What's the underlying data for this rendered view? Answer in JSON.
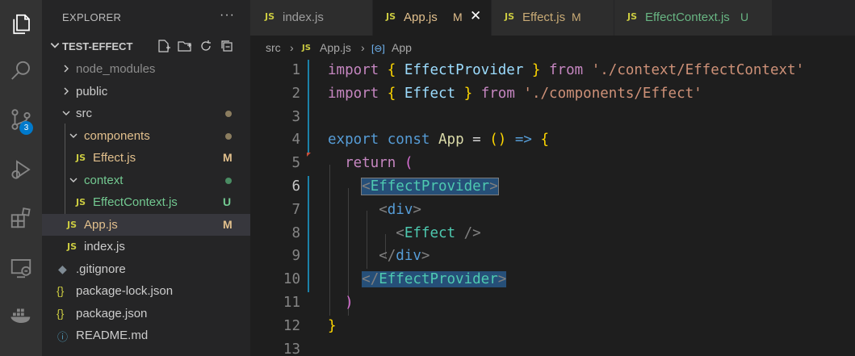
{
  "activity_bar": {
    "icons": [
      "explorer-icon",
      "search-icon",
      "source-control-icon",
      "run-debug-icon",
      "extensions-icon",
      "remote-explorer-icon",
      "docker-icon"
    ],
    "source_control_badge": "3"
  },
  "sidebar": {
    "title": "EXPLORER",
    "more": "···",
    "project": "TEST-EFFECT",
    "tree": [
      {
        "label": "node_modules",
        "type": "folder",
        "state": "collapsed"
      },
      {
        "label": "public",
        "type": "folder",
        "state": "collapsed"
      },
      {
        "label": "src",
        "type": "folder",
        "state": "expanded"
      },
      {
        "label": "components",
        "type": "folder",
        "state": "expanded"
      },
      {
        "label": "Effect.js",
        "type": "js",
        "status": "M"
      },
      {
        "label": "context",
        "type": "folder",
        "state": "expanded"
      },
      {
        "label": "EffectContext.js",
        "type": "js",
        "status": "U"
      },
      {
        "label": "App.js",
        "type": "js",
        "status": "M"
      },
      {
        "label": "index.js",
        "type": "js"
      },
      {
        "label": ".gitignore",
        "type": "git"
      },
      {
        "label": "package-lock.json",
        "type": "json"
      },
      {
        "label": "package.json",
        "type": "json"
      },
      {
        "label": "README.md",
        "type": "info"
      }
    ]
  },
  "tabs": [
    {
      "label": "index.js",
      "status": ""
    },
    {
      "label": "App.js",
      "status": "M",
      "active": true
    },
    {
      "label": "Effect.js",
      "status": "M"
    },
    {
      "label": "EffectContext.js",
      "status": "U"
    }
  ],
  "breadcrumb": {
    "folder": "src",
    "file": "App.js",
    "symbol": "App"
  },
  "editor": {
    "line_numbers": [
      "1",
      "2",
      "3",
      "4",
      "5",
      "6",
      "7",
      "8",
      "9",
      "10",
      "11",
      "12",
      "13"
    ],
    "current_line": "6",
    "tokens": {
      "import": "import",
      "from": "from",
      "export": "export",
      "const": "const",
      "return": "return",
      "EffectProvider": "EffectProvider",
      "Effect": "Effect",
      "App": "App",
      "div": "div",
      "path1": "'./context/EffectContext'",
      "path2": "'./components/Effect'"
    }
  },
  "colors": {
    "modified": "#e2c08d",
    "untracked": "#73c991",
    "accent": "#007acc"
  }
}
